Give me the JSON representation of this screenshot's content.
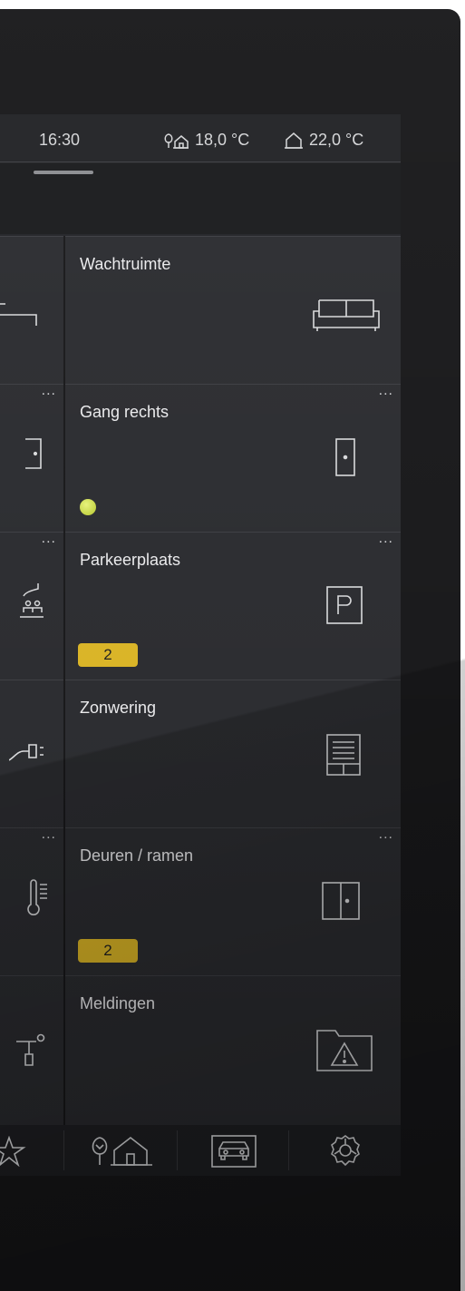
{
  "status": {
    "time": "16:30",
    "outdoor_temp": "18,0 °C",
    "indoor_temp": "22,0 °C"
  },
  "tiles": [
    {
      "label": "Wachtruimte",
      "icon": "sofa-icon"
    },
    {
      "label": "Gang rechts",
      "icon": "door-icon",
      "indicator": "status-led",
      "more": "..."
    },
    {
      "label": "Parkeerplaats",
      "icon": "parking-icon",
      "badge": "2",
      "more": "..."
    },
    {
      "label": "Zonwering",
      "icon": "blinds-icon"
    },
    {
      "label": "Deuren / ramen",
      "icon": "window-icon",
      "badge": "2",
      "more": "..."
    },
    {
      "label": "Meldingen",
      "icon": "warning-folder-icon"
    }
  ],
  "left_column_more": "...",
  "colors": {
    "badge": "#d9b323",
    "led": "#c9d83a",
    "tile": "#28292d",
    "background": "#151517"
  },
  "nav": [
    "star-icon",
    "house-tree-icon",
    "car-icon",
    "gear-icon"
  ]
}
